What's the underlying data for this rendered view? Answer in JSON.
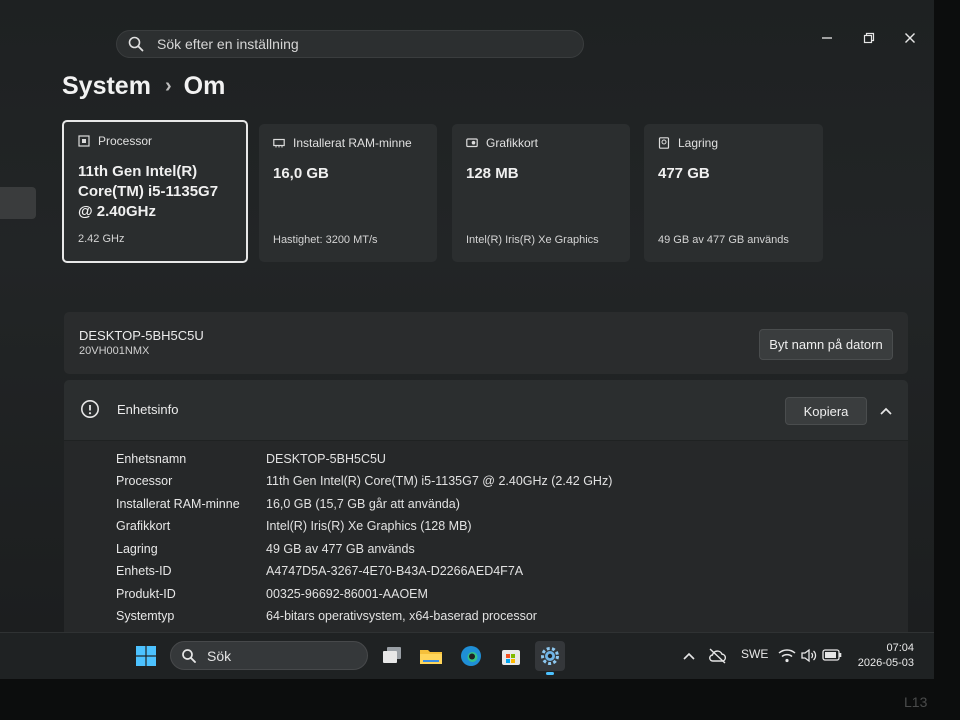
{
  "search": {
    "placeholder": "Sök efter en inställning"
  },
  "breadcrumb": {
    "parent": "System",
    "separator": "›",
    "current": "Om"
  },
  "cards": [
    {
      "title": "Processor",
      "value": "11th Gen Intel(R) Core(TM) i5-1135G7 @ 2.40GHz",
      "sub": "2.42 GHz"
    },
    {
      "title": "Installerat RAM-minne",
      "value": "16,0 GB",
      "sub": "Hastighet: 3200 MT/s"
    },
    {
      "title": "Grafikkort",
      "value": "128 MB",
      "sub": "Intel(R) Iris(R) Xe Graphics"
    },
    {
      "title": "Lagring",
      "value": "477 GB",
      "sub": "49 GB av 477 GB används"
    }
  ],
  "device": {
    "name": "DESKTOP-5BH5C5U",
    "model": "20VH001NMX",
    "rename_label": "Byt namn på datorn"
  },
  "info": {
    "title": "Enhetsinfo",
    "copy_label": "Kopiera",
    "rows": [
      {
        "key": "Enhetsnamn",
        "value": "DESKTOP-5BH5C5U"
      },
      {
        "key": "Processor",
        "value": "11th Gen Intel(R) Core(TM) i5-1135G7 @ 2.40GHz (2.42 GHz)"
      },
      {
        "key": "Installerat RAM-minne",
        "value": "16,0 GB (15,7 GB går att använda)"
      },
      {
        "key": "Grafikkort",
        "value": "Intel(R) Iris(R) Xe Graphics (128 MB)"
      },
      {
        "key": "Lagring",
        "value": "49 GB av 477 GB används"
      },
      {
        "key": "Enhets-ID",
        "value": "A4747D5A-3267-4E70-B43A-D2266AED4F7A"
      },
      {
        "key": "Produkt-ID",
        "value": "00325-96692-86001-AAOEM"
      },
      {
        "key": "Systemtyp",
        "value": "64-bitars operativsystem, x64-baserad processor"
      }
    ]
  },
  "taskbar": {
    "search_label": "Sök",
    "language": "SWE",
    "time": "07:04",
    "date": "2026-05-03"
  },
  "bezel_label": "L13",
  "colors": {
    "accent": "#4cc2ff",
    "card_bg": "#2b2e2f",
    "window_bg": "#202324"
  }
}
